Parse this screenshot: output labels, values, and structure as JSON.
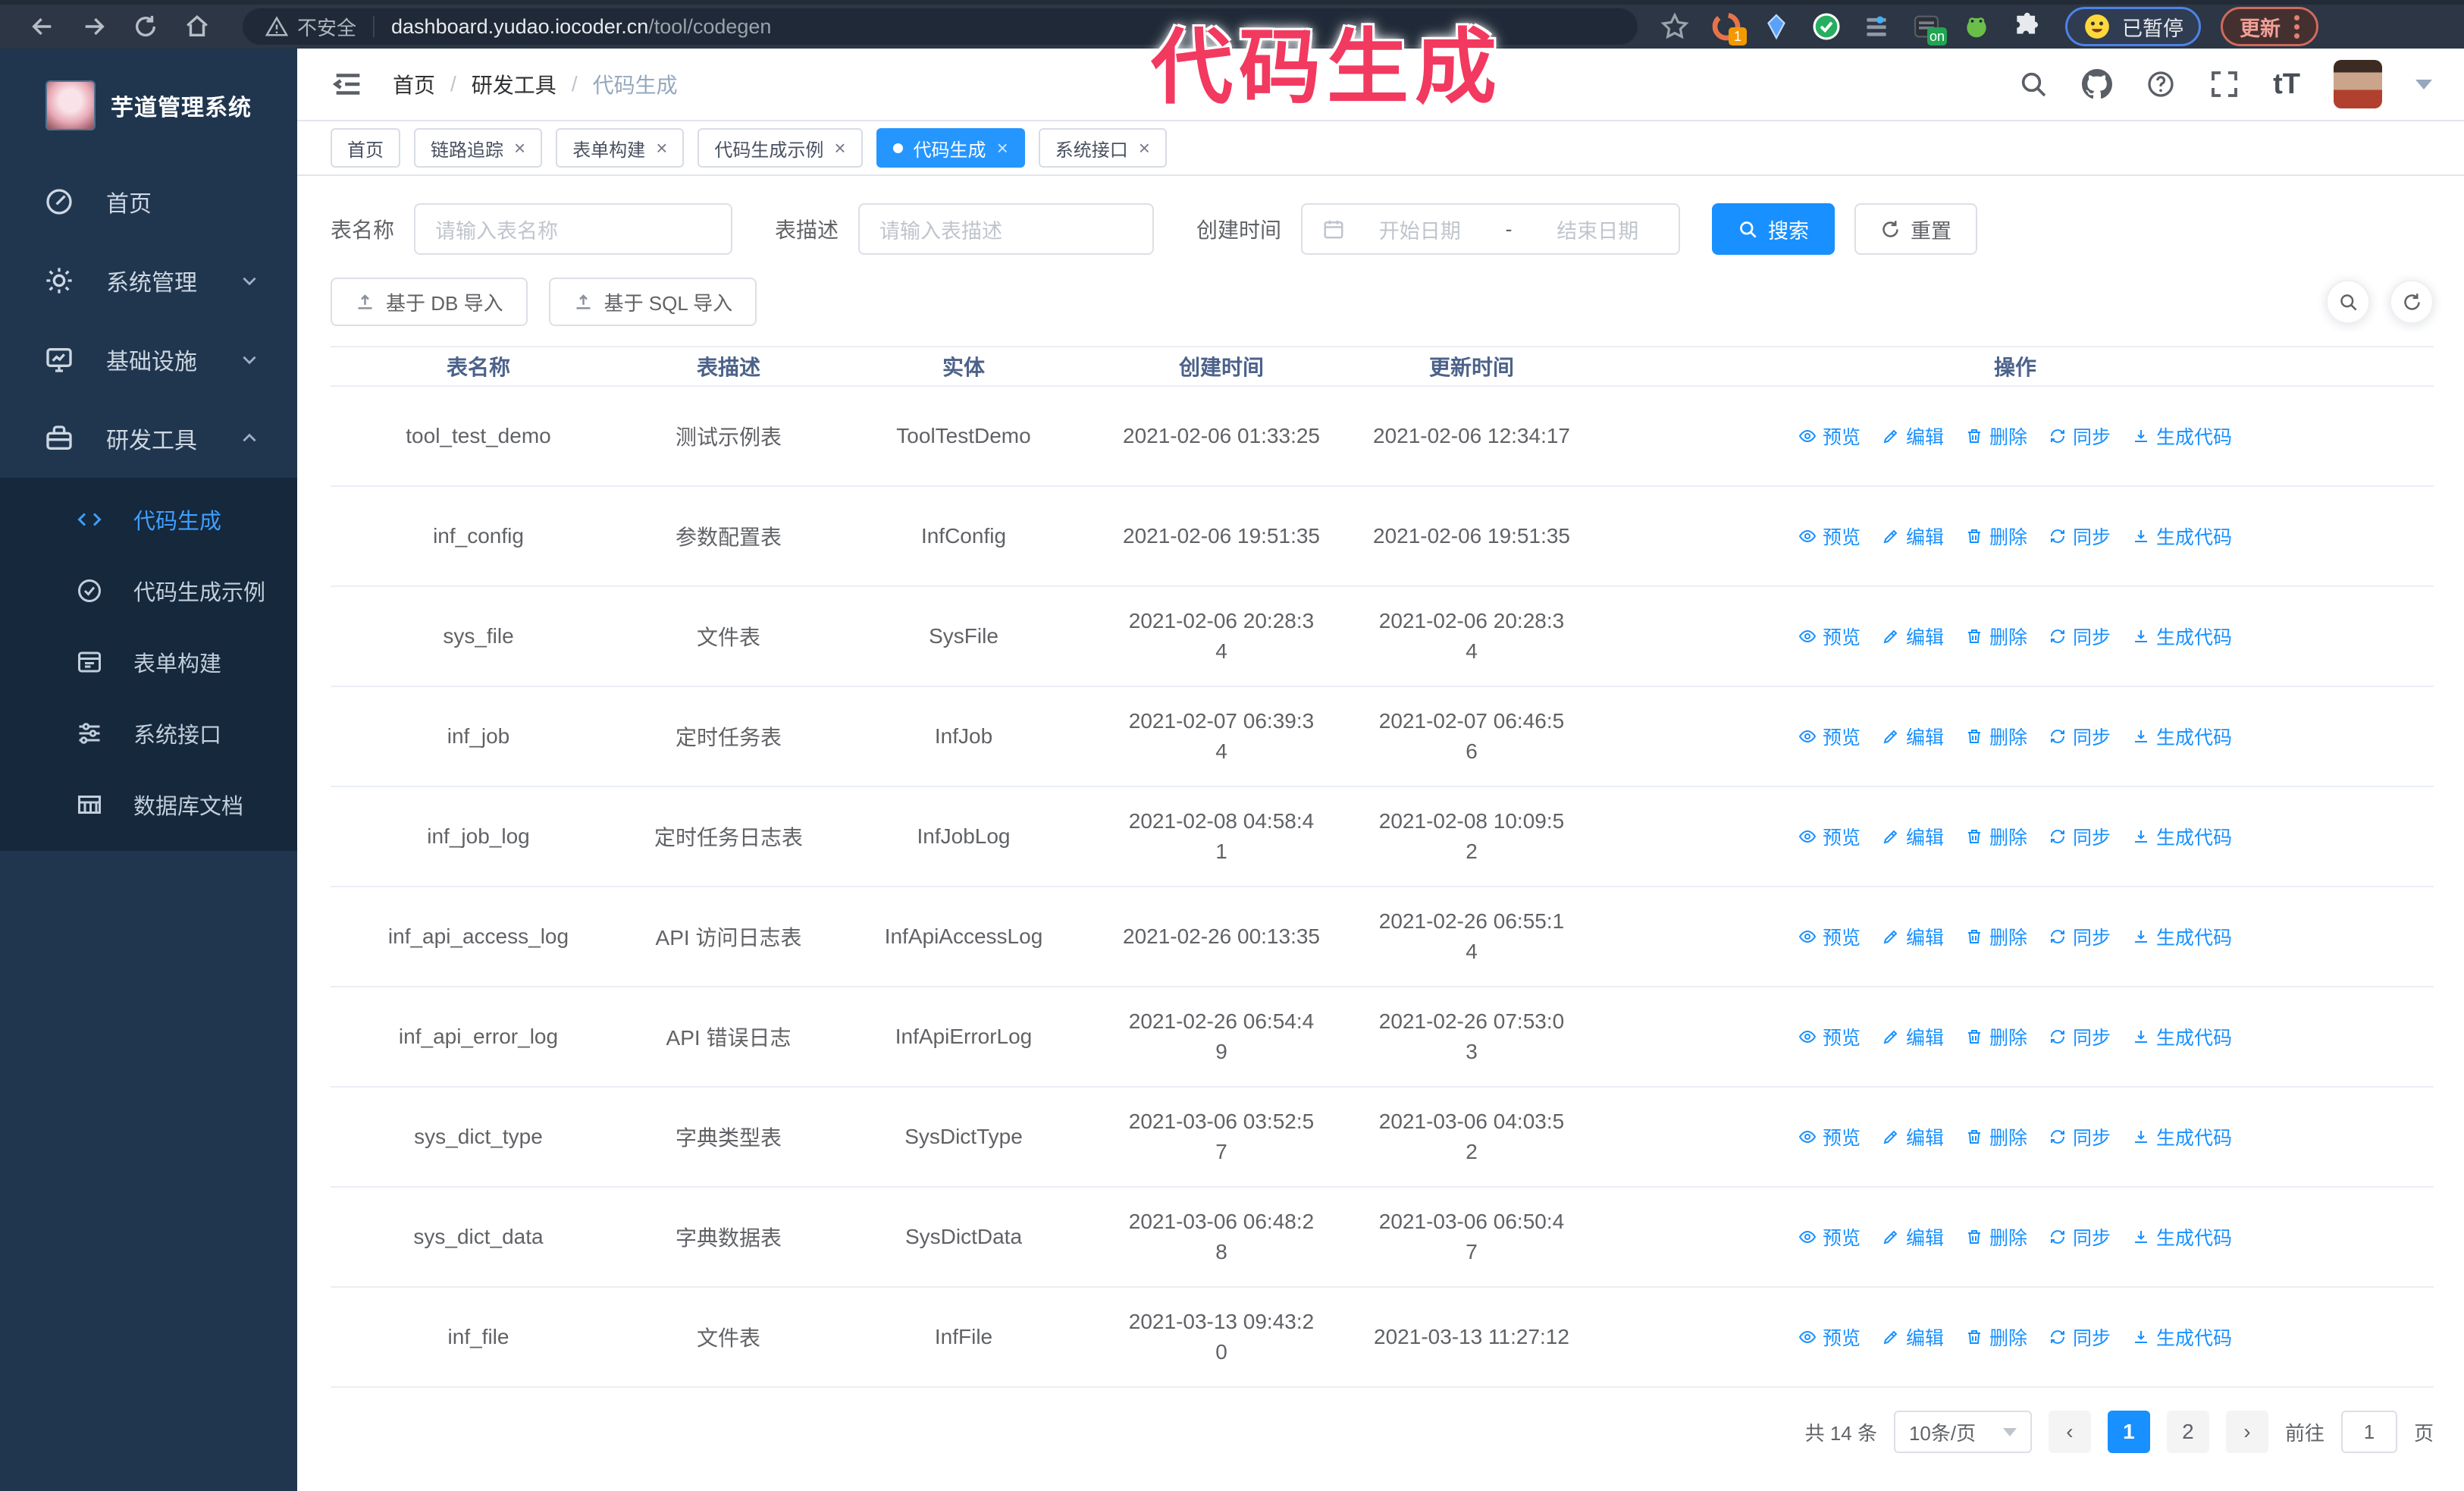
{
  "colors": {
    "primary": "#1890ff",
    "sidebar_active": "#409eff",
    "annotation": "#f2395f",
    "sidebar_bg": "#20364f",
    "chrome_bg": "#2c3644"
  },
  "browser": {
    "security_label": "不安全",
    "url_domain": "dashboard.yudao.iocoder.cn",
    "url_path": "/tool/codegen",
    "extension_badge": "1",
    "extension_on_badge": "on",
    "paused_badge": "已暂停",
    "update_button": "更新"
  },
  "annotation": {
    "text": "代码生成"
  },
  "sidebar": {
    "title": "芋道管理系统",
    "items": [
      {
        "label": "首页"
      },
      {
        "label": "系统管理"
      },
      {
        "label": "基础设施"
      },
      {
        "label": "研发工具"
      }
    ],
    "subitems": [
      {
        "label": "代码生成"
      },
      {
        "label": "代码生成示例"
      },
      {
        "label": "表单构建"
      },
      {
        "label": "系统接口"
      },
      {
        "label": "数据库文档"
      }
    ]
  },
  "navbar": {
    "breadcrumb": [
      "首页",
      "研发工具",
      "代码生成"
    ],
    "separator": "/",
    "font_icon_text": "tT"
  },
  "tabs_meta": {
    "close_glyph": "×"
  },
  "tabs": [
    {
      "label": "首页",
      "closable": false,
      "active": false
    },
    {
      "label": "链路追踪",
      "closable": true,
      "active": false
    },
    {
      "label": "表单构建",
      "closable": true,
      "active": false
    },
    {
      "label": "代码生成示例",
      "closable": true,
      "active": false
    },
    {
      "label": "代码生成",
      "closable": true,
      "active": true
    },
    {
      "label": "系统接口",
      "closable": true,
      "active": false
    }
  ],
  "filters": {
    "table_name_label": "表名称",
    "table_name_placeholder": "请输入表名称",
    "table_desc_label": "表描述",
    "table_desc_placeholder": "请输入表描述",
    "create_time_label": "创建时间",
    "start_placeholder": "开始日期",
    "date_separator": "-",
    "end_placeholder": "结束日期",
    "search_button": "搜索",
    "reset_button": "重置"
  },
  "toolbar": {
    "import_db": "基于 DB 导入",
    "import_sql": "基于 SQL 导入"
  },
  "table": {
    "columns": [
      "表名称",
      "表描述",
      "实体",
      "创建时间",
      "更新时间",
      "操作"
    ],
    "actions": [
      "预览",
      "编辑",
      "删除",
      "同步",
      "生成代码"
    ],
    "rows": [
      {
        "name": "tool_test_demo",
        "desc": "测试示例表",
        "entity": "ToolTestDemo",
        "created": "2021-02-06 01:33:25",
        "updated": "2021-02-06 12:34:17"
      },
      {
        "name": "inf_config",
        "desc": "参数配置表",
        "entity": "InfConfig",
        "created": "2021-02-06 19:51:35",
        "updated": "2021-02-06 19:51:35"
      },
      {
        "name": "sys_file",
        "desc": "文件表",
        "entity": "SysFile",
        "created": "2021-02-06 20:28:3\n4",
        "updated": "2021-02-06 20:28:3\n4"
      },
      {
        "name": "inf_job",
        "desc": "定时任务表",
        "entity": "InfJob",
        "created": "2021-02-07 06:39:3\n4",
        "updated": "2021-02-07 06:46:5\n6"
      },
      {
        "name": "inf_job_log",
        "desc": "定时任务日志表",
        "entity": "InfJobLog",
        "created": "2021-02-08 04:58:4\n1",
        "updated": "2021-02-08 10:09:5\n2"
      },
      {
        "name": "inf_api_access_log",
        "desc": "API 访问日志表",
        "entity": "InfApiAccessLog",
        "created": "2021-02-26 00:13:35",
        "updated": "2021-02-26 06:55:1\n4"
      },
      {
        "name": "inf_api_error_log",
        "desc": "API 错误日志",
        "entity": "InfApiErrorLog",
        "created": "2021-02-26 06:54:4\n9",
        "updated": "2021-02-26 07:53:0\n3"
      },
      {
        "name": "sys_dict_type",
        "desc": "字典类型表",
        "entity": "SysDictType",
        "created": "2021-03-06 03:52:5\n7",
        "updated": "2021-03-06 04:03:5\n2"
      },
      {
        "name": "sys_dict_data",
        "desc": "字典数据表",
        "entity": "SysDictData",
        "created": "2021-03-06 06:48:2\n8",
        "updated": "2021-03-06 06:50:4\n7"
      },
      {
        "name": "inf_file",
        "desc": "文件表",
        "entity": "InfFile",
        "created": "2021-03-13 09:43:2\n0",
        "updated": "2021-03-13 11:27:12"
      }
    ]
  },
  "pagination": {
    "total": "共 14 条",
    "page_size": "10条/页",
    "prev_glyph": "‹",
    "next_glyph": "›",
    "pages": [
      "1",
      "2"
    ],
    "active_page": "1",
    "goto_label": "前往",
    "goto_value": "1",
    "goto_suffix": "页"
  }
}
